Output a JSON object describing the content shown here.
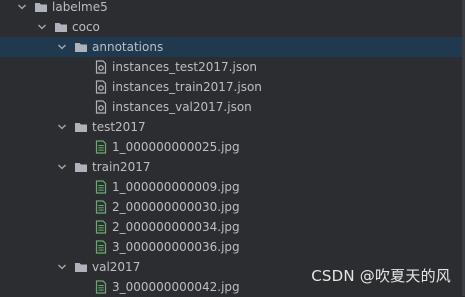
{
  "tree": [
    {
      "label": "labelme5",
      "kind": "folder",
      "depth": 0,
      "expanded": true
    },
    {
      "label": "coco",
      "kind": "folder",
      "depth": 1,
      "expanded": true
    },
    {
      "label": "annotations",
      "kind": "folder",
      "depth": 2,
      "expanded": true,
      "selected": true
    },
    {
      "label": "instances_test2017.json",
      "kind": "json",
      "depth": 3
    },
    {
      "label": "instances_train2017.json",
      "kind": "json",
      "depth": 3
    },
    {
      "label": "instances_val2017.json",
      "kind": "json",
      "depth": 3
    },
    {
      "label": "test2017",
      "kind": "folder",
      "depth": 2,
      "expanded": true
    },
    {
      "label": "1_000000000025.jpg",
      "kind": "image",
      "depth": 3
    },
    {
      "label": "train2017",
      "kind": "folder",
      "depth": 2,
      "expanded": true
    },
    {
      "label": "1_000000000009.jpg",
      "kind": "image",
      "depth": 3
    },
    {
      "label": "2_000000000030.jpg",
      "kind": "image",
      "depth": 3
    },
    {
      "label": "2_000000000034.jpg",
      "kind": "image",
      "depth": 3
    },
    {
      "label": "3_000000000036.jpg",
      "kind": "image",
      "depth": 3
    },
    {
      "label": "val2017",
      "kind": "folder",
      "depth": 2,
      "expanded": true
    },
    {
      "label": "3_000000000042.jpg",
      "kind": "image",
      "depth": 3
    }
  ],
  "watermark": "CSDN @吹夏天的风",
  "colors": {
    "background": "#2b2d30",
    "text": "#bcbec4",
    "selection": "#1f3a4f",
    "folder": "#aeb3bb",
    "file_icon": "#aeb3bb",
    "image_icon": "#6aab73"
  }
}
